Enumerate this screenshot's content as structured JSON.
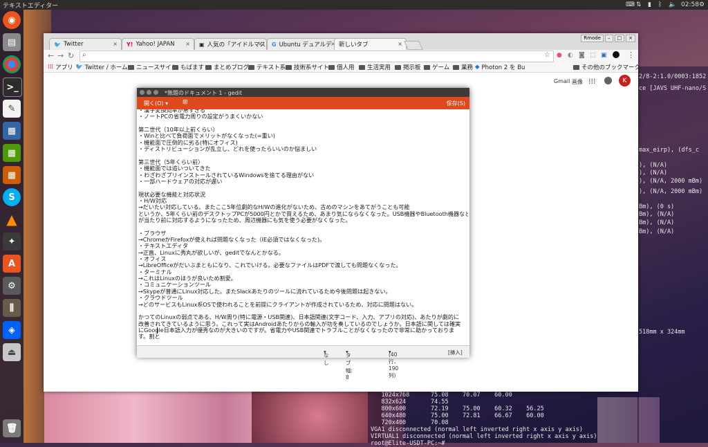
{
  "top_panel": {
    "app_title": "テキストエディター",
    "clock": "02:58"
  },
  "chrome": {
    "tabs": [
      {
        "label": "Twitter",
        "favicon": "twitter-icon"
      },
      {
        "label": "Yahoo! JAPAN",
        "favicon": "yahoo-icon"
      },
      {
        "label": "人気の「アイドルマス",
        "favicon": "page-icon"
      },
      {
        "label": "Ubuntu デュアルデ",
        "favicon": "google-icon"
      },
      {
        "label": "新しいタブ",
        "favicon": ""
      }
    ],
    "window_badge": "Rmode",
    "bookmarks": [
      {
        "label": "アプリ",
        "icon": "apps-grid-icon"
      },
      {
        "label": "Twitter / ホーム",
        "icon": "twitter-icon"
      },
      {
        "label": "ニュースサイト",
        "icon": "folder-icon"
      },
      {
        "label": "もばます",
        "icon": "folder-icon"
      },
      {
        "label": "まとめブログ",
        "icon": "folder-icon"
      },
      {
        "label": "テキスト系",
        "icon": "folder-icon"
      },
      {
        "label": "技術系サイト",
        "icon": "folder-icon"
      },
      {
        "label": "個人用",
        "icon": "folder-icon"
      },
      {
        "label": "生活実用",
        "icon": "folder-icon"
      },
      {
        "label": "掲示板",
        "icon": "folder-icon"
      },
      {
        "label": "ゲーム",
        "icon": "folder-icon"
      },
      {
        "label": "業務",
        "icon": "folder-icon"
      },
      {
        "label": "Photon 2 を Bu",
        "icon": "photon-icon"
      }
    ],
    "other_bookmarks": "その他のブックマーク",
    "google_links": {
      "gmail": "Gmail",
      "images": "画像"
    },
    "avatar_letter": "K"
  },
  "gedit": {
    "title": "*無題のドキュメント 1 - gedit",
    "open_label": "開く(O)",
    "save_label": "保存(S)",
    "lines": [
      "・漢字変換効率が悪すぎる",
      "・ノートPCの省電力周りの設定がうまくいかない",
      "",
      "第二世代（10年以上前くらい）",
      "・Winと比べて負荷面でメリットがなくなった(=重い)",
      "・機能面で圧倒的に劣る(特にオフィス)",
      "・ディストリビューションが乱立し、どれを使ったらいいのか悩ましい",
      "",
      "第三世代（5年くらい前）",
      "・機能面では追いついてきた",
      "・わざわざプリインストールされているWindowsを捨てる理由がない",
      "・一部ハードウェアの対応が遅い",
      "",
      "現状必要な機能と対応状況",
      "・H/W対応",
      "→だいたい対応している、またここ5年位劇的なH/Wの進化がないため、古めのマシンをあてがうことも可能",
      "というか、5年くらい前のデスクトップPCが5000円とかで買えるため、あまり気にならなくなった。USB機器やBluetooth機器など",
      "が当たり前に対応するようになったため、周辺機器にも気を使う必要がなくなった。",
      "",
      "・ブラウザ",
      "→ChromeかFirefoxが使えれば問題なくなった（IE必須ではなくなった)。",
      "・テキストエディタ",
      "→正直、Linuxに秀丸が欲しいが、geditでなんとかなる。",
      "・オフィス",
      "→LibreOfficeがだいぶまともになり、これでいける。必要なファイルはPDFで渡しても問題なくなった。",
      "・ターミナル",
      "→これはLinuxのほうが良いため割愛。",
      "・コミュニケーションツール",
      "→Skypeが普通にLinux対応した。またSlackあたりのツールに流れているため今後問題は起きない。",
      "・クラウドツール",
      "→どのサービスもLinux系OSで使われることを前提にクライアントが作成されているため、対応に問題はない。",
      "",
      "かつてのLinuxの弱点である、H/W周り(特に電源・USB関連)、日本語関連(文字コード、入力、アプリの対応)、あたりが劇的に",
      "改善されてきているように思う。これって実はAndroidあたりからの輸入が功を奏しているのでしょうか。日本語に関しては確実",
      "にGoogle日本語入力が優秀なのが大きいのですが。省電力やUSB関連でトラブルことがなくなったので非常に助かっておりま",
      "す。割と"
    ],
    "status": {
      "highlight": "なし",
      "tab_width": "タブ幅: 8",
      "position": "(40行、190列)",
      "mode": "[挿入]"
    }
  },
  "terminal": {
    "right_lines": [
      "2/8-2:1.0/0003:1852",
      "ce [JAVS UHF-nano/S",
      "max_eirp), (dfs_c",
      "), (N/A)",
      "), (N/A)",
      "), (N/A, 2000 mBm)",
      "), (N/A, 2000 mBm)",
      "Bm), (0 s)",
      "Bm), (N/A)",
      "Bm), (N/A)",
      "Bm), (N/A)",
      "518mm x 324mm"
    ],
    "bottom_lines": [
      "   1024x768      75.08    70.07    60.00",
      "   832x624       74.55",
      "   800x600       72.19    75.00    60.32    56.25",
      "   640x480       75.00    72.81    66.67    60.00",
      "   720x400       70.08",
      "VGA1 disconnected (normal left inverted right x axis y axis)",
      "VIRTUAL1 disconnected (normal left inverted right x axis y axis)",
      "root@Elite-USDT-PC:~# "
    ]
  }
}
